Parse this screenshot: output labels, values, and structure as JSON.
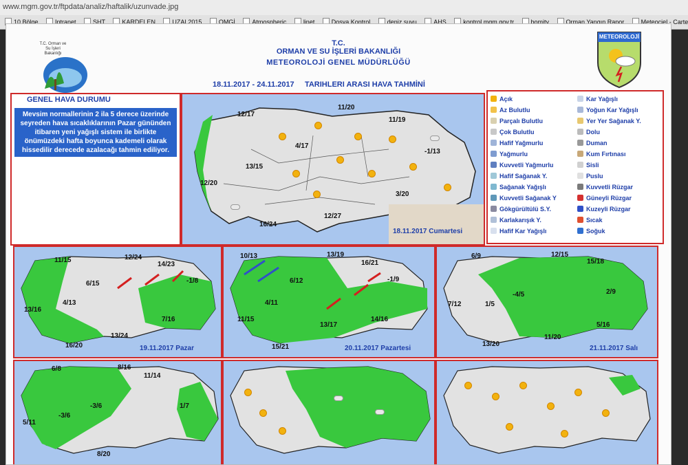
{
  "browser": {
    "url": "www.mgm.gov.tr/ftpdata/analiz/haftalik/uzunvade.jpg"
  },
  "bookmarks": [
    "10.Bölge",
    "Intranet",
    "SHT",
    "KARDELEN",
    "UZAL2015",
    "OMGİ",
    "Atmospheric",
    "linet",
    "Dosya Kontrol",
    "deniz suyu",
    "AHS",
    "kontrol.mgm.gov.tr",
    "bomity",
    "Orman Yangın Rapor",
    "Meteociel - Cartes d"
  ],
  "header": {
    "tc": "T.C.",
    "ministry": "ORMAN VE SU İŞLERİ BAKANLIĞI",
    "directorate": "METEOROLOJİ GENEL MÜDÜRLÜĞÜ",
    "dates": "18.11.2017  -  24.11.2017",
    "forecast_title": "TARIHLERI ARASI HAVA TAHMİNİ",
    "left_logo_text": "T.C. Orman ve Su İşleri Bakanlığı",
    "right_logo_text": "METEOROLOJİ"
  },
  "general": {
    "title": "GENEL HAVA DURUMU",
    "text": "Mevsim normallerinin 2 ila 5 derece üzerinde seyreden hava sıcaklıklarının Pazar gününden itibaren yeni yağışlı sistem ile birlikte önümüzdeki hafta boyunca kademeli olarak hissedilir derecede azalacağı tahmin ediliyor."
  },
  "main_map": {
    "label": "18.11.2017 Cumartesi",
    "temps": [
      "12/17",
      "11/20",
      "11/19",
      "4/17",
      "-1/13",
      "13/15",
      "12/20",
      "3/20",
      "12/27",
      "16/24"
    ]
  },
  "legend": {
    "col1": [
      "Açık",
      "Az Bulutlu",
      "Parçalı Bulutlu",
      "Çok Bulutlu",
      "Hafif Yağmurlu",
      "Yağmurlu",
      "Kuvvetli Yağmurlu",
      "Hafif Sağanak Y.",
      "Sağanak Yağışlı",
      "Kuvvetli Sağanak Y",
      "Gökgürültülü S.Y.",
      "Karlakarışık Y.",
      "Hafif Kar Yağışlı"
    ],
    "col2": [
      "Kar Yağışlı",
      "Yoğun Kar Yağışlı",
      "Yer Yer Sağanak Y.",
      "Dolu",
      "Duman",
      "Kum Fırtınası",
      "Sisli",
      "Puslu",
      "Kuvvetli Rüzgar",
      "Güneyli Rüzgar",
      "Kuzeyli Rüzgar",
      "Sıcak",
      "Soğuk"
    ]
  },
  "day_maps": [
    {
      "label": "19.11.2017 Pazar",
      "temps": [
        "11/15",
        "12/24",
        "14/23",
        "-1/8",
        "6/15",
        "4/13",
        "7/16",
        "13/16",
        "16/20",
        "13/24"
      ]
    },
    {
      "label": "20.11.2017 Pazartesi",
      "temps": [
        "10/13",
        "13/19",
        "16/21",
        "6/12",
        "4/11",
        "-1/9",
        "11/15",
        "13/17",
        "15/21",
        "14/16"
      ]
    },
    {
      "label": "21.11.2017 Salı",
      "temps": [
        "6/9",
        "12/15",
        "15/18",
        "2/9",
        "7/12",
        "1/5",
        "-4/5",
        "5/16",
        "11/20",
        "13/20"
      ]
    },
    {
      "label": "",
      "temps": [
        "6/8",
        "8/16",
        "11/14",
        "-3/6",
        "-3/6",
        "1/7",
        "5/11",
        "8/20"
      ]
    },
    {
      "label": "",
      "temps": []
    },
    {
      "label": "",
      "temps": []
    }
  ],
  "colors": {
    "accent": "#1e3ea8",
    "frame": "#cf2a2a",
    "sea": "#a9c6ee",
    "land": "#e2e2e2",
    "rain": "#39c83e",
    "blue_box": "#2a63c9"
  }
}
